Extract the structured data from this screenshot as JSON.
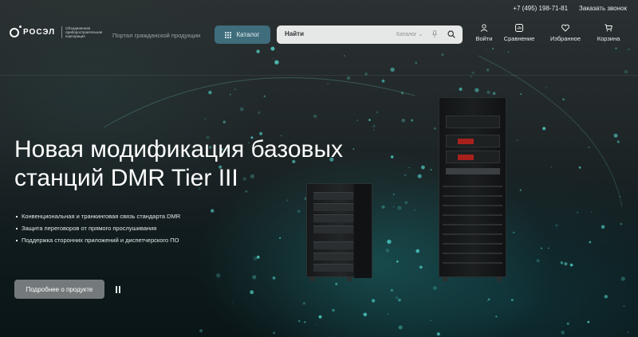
{
  "topbar": {
    "phone": "+7 (495) 198-71-81",
    "callback_link": "Заказать звонок"
  },
  "header": {
    "logo_text": "РОСЭЛ",
    "logo_subtitle": "Объединенная приборостроительная корпорация",
    "portal_label": "Портал гражданской продукции",
    "catalog_button": "Каталог",
    "search": {
      "placeholder": "Найти",
      "category": "Каталог"
    },
    "actions": [
      {
        "label": "Войти",
        "icon": "user-icon"
      },
      {
        "label": "Сравнение",
        "icon": "compare-icon"
      },
      {
        "label": "Избранное",
        "icon": "heart-icon"
      },
      {
        "label": "Корзина",
        "icon": "cart-icon"
      }
    ]
  },
  "hero": {
    "title_line1": "Новая модификация базовых",
    "title_line2": "станций DMR Tier III",
    "bullets": [
      "Конвенциональная и транкинговая связь стандарта DMR",
      "Защита переговоров от прямого прослушивания",
      "Поддержка сторонних приложений и диспетчерского ПО"
    ],
    "cta_button": "Подробнее о продукте"
  },
  "colors": {
    "catalog_button": "#3f6d7c",
    "search_bg": "#e6e7e7",
    "cta_button": "#747a7b",
    "accent_teal": "#3fd0d0"
  }
}
